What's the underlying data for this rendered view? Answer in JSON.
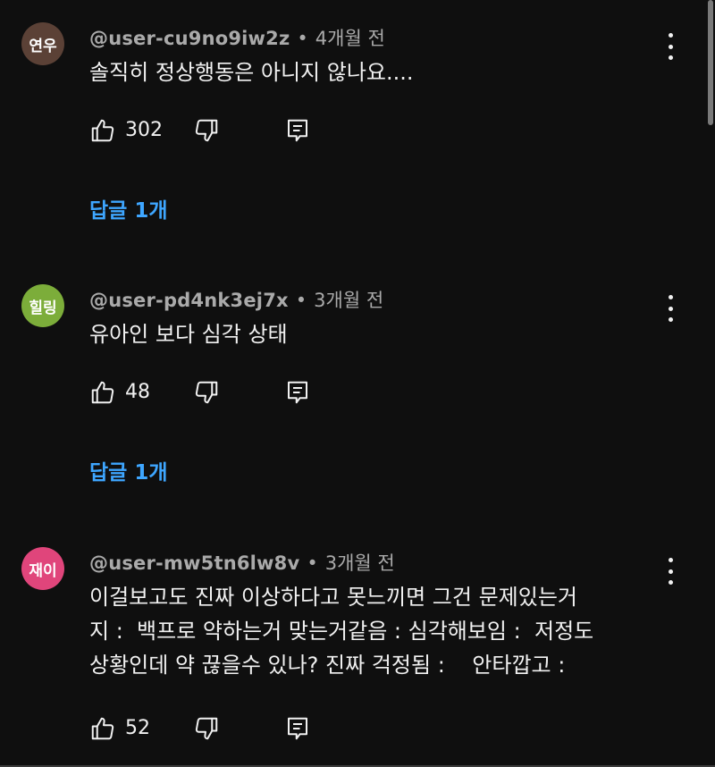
{
  "comments": [
    {
      "avatar_text": "연우",
      "avatar_color": "#5b4136",
      "handle": "@user-cu9no9iw2z",
      "separator": "•",
      "time": "4개월 전",
      "text": "솔직히 정상행동은 아니지 않나요....",
      "likes": "302",
      "replies": "답글 1개"
    },
    {
      "avatar_text": "힐링",
      "avatar_color": "#7cad3a",
      "handle": "@user-pd4nk3ej7x",
      "separator": "•",
      "time": "3개월 전",
      "text": "유아인 보다 심각 상태",
      "likes": "48",
      "replies": "답글 1개"
    },
    {
      "avatar_text": "재이",
      "avatar_color": "#e0457b",
      "handle": "@user-mw5tn6lw8v",
      "separator": "•",
      "time": "3개월 전",
      "text_lines": [
        "이걸보고도 진짜 이상하다고 못느끼면 그건 문제있는거",
        "지 :  백프로 약하는거 맞는거같음 : 심각해보임 :  저정도",
        "상황인데 약 끊을수 있나? 진짜 걱정됨 :    안타깝고 :"
      ],
      "likes": "52"
    }
  ],
  "icons": {
    "like": "thumbs-up-icon",
    "dislike": "thumbs-down-icon",
    "reply": "reply-icon",
    "more": "more-vert-icon"
  },
  "colors": {
    "background": "#0f0f0f",
    "text": "#f1f1f1",
    "meta": "#aaaaaa",
    "link": "#3ea6ff"
  }
}
